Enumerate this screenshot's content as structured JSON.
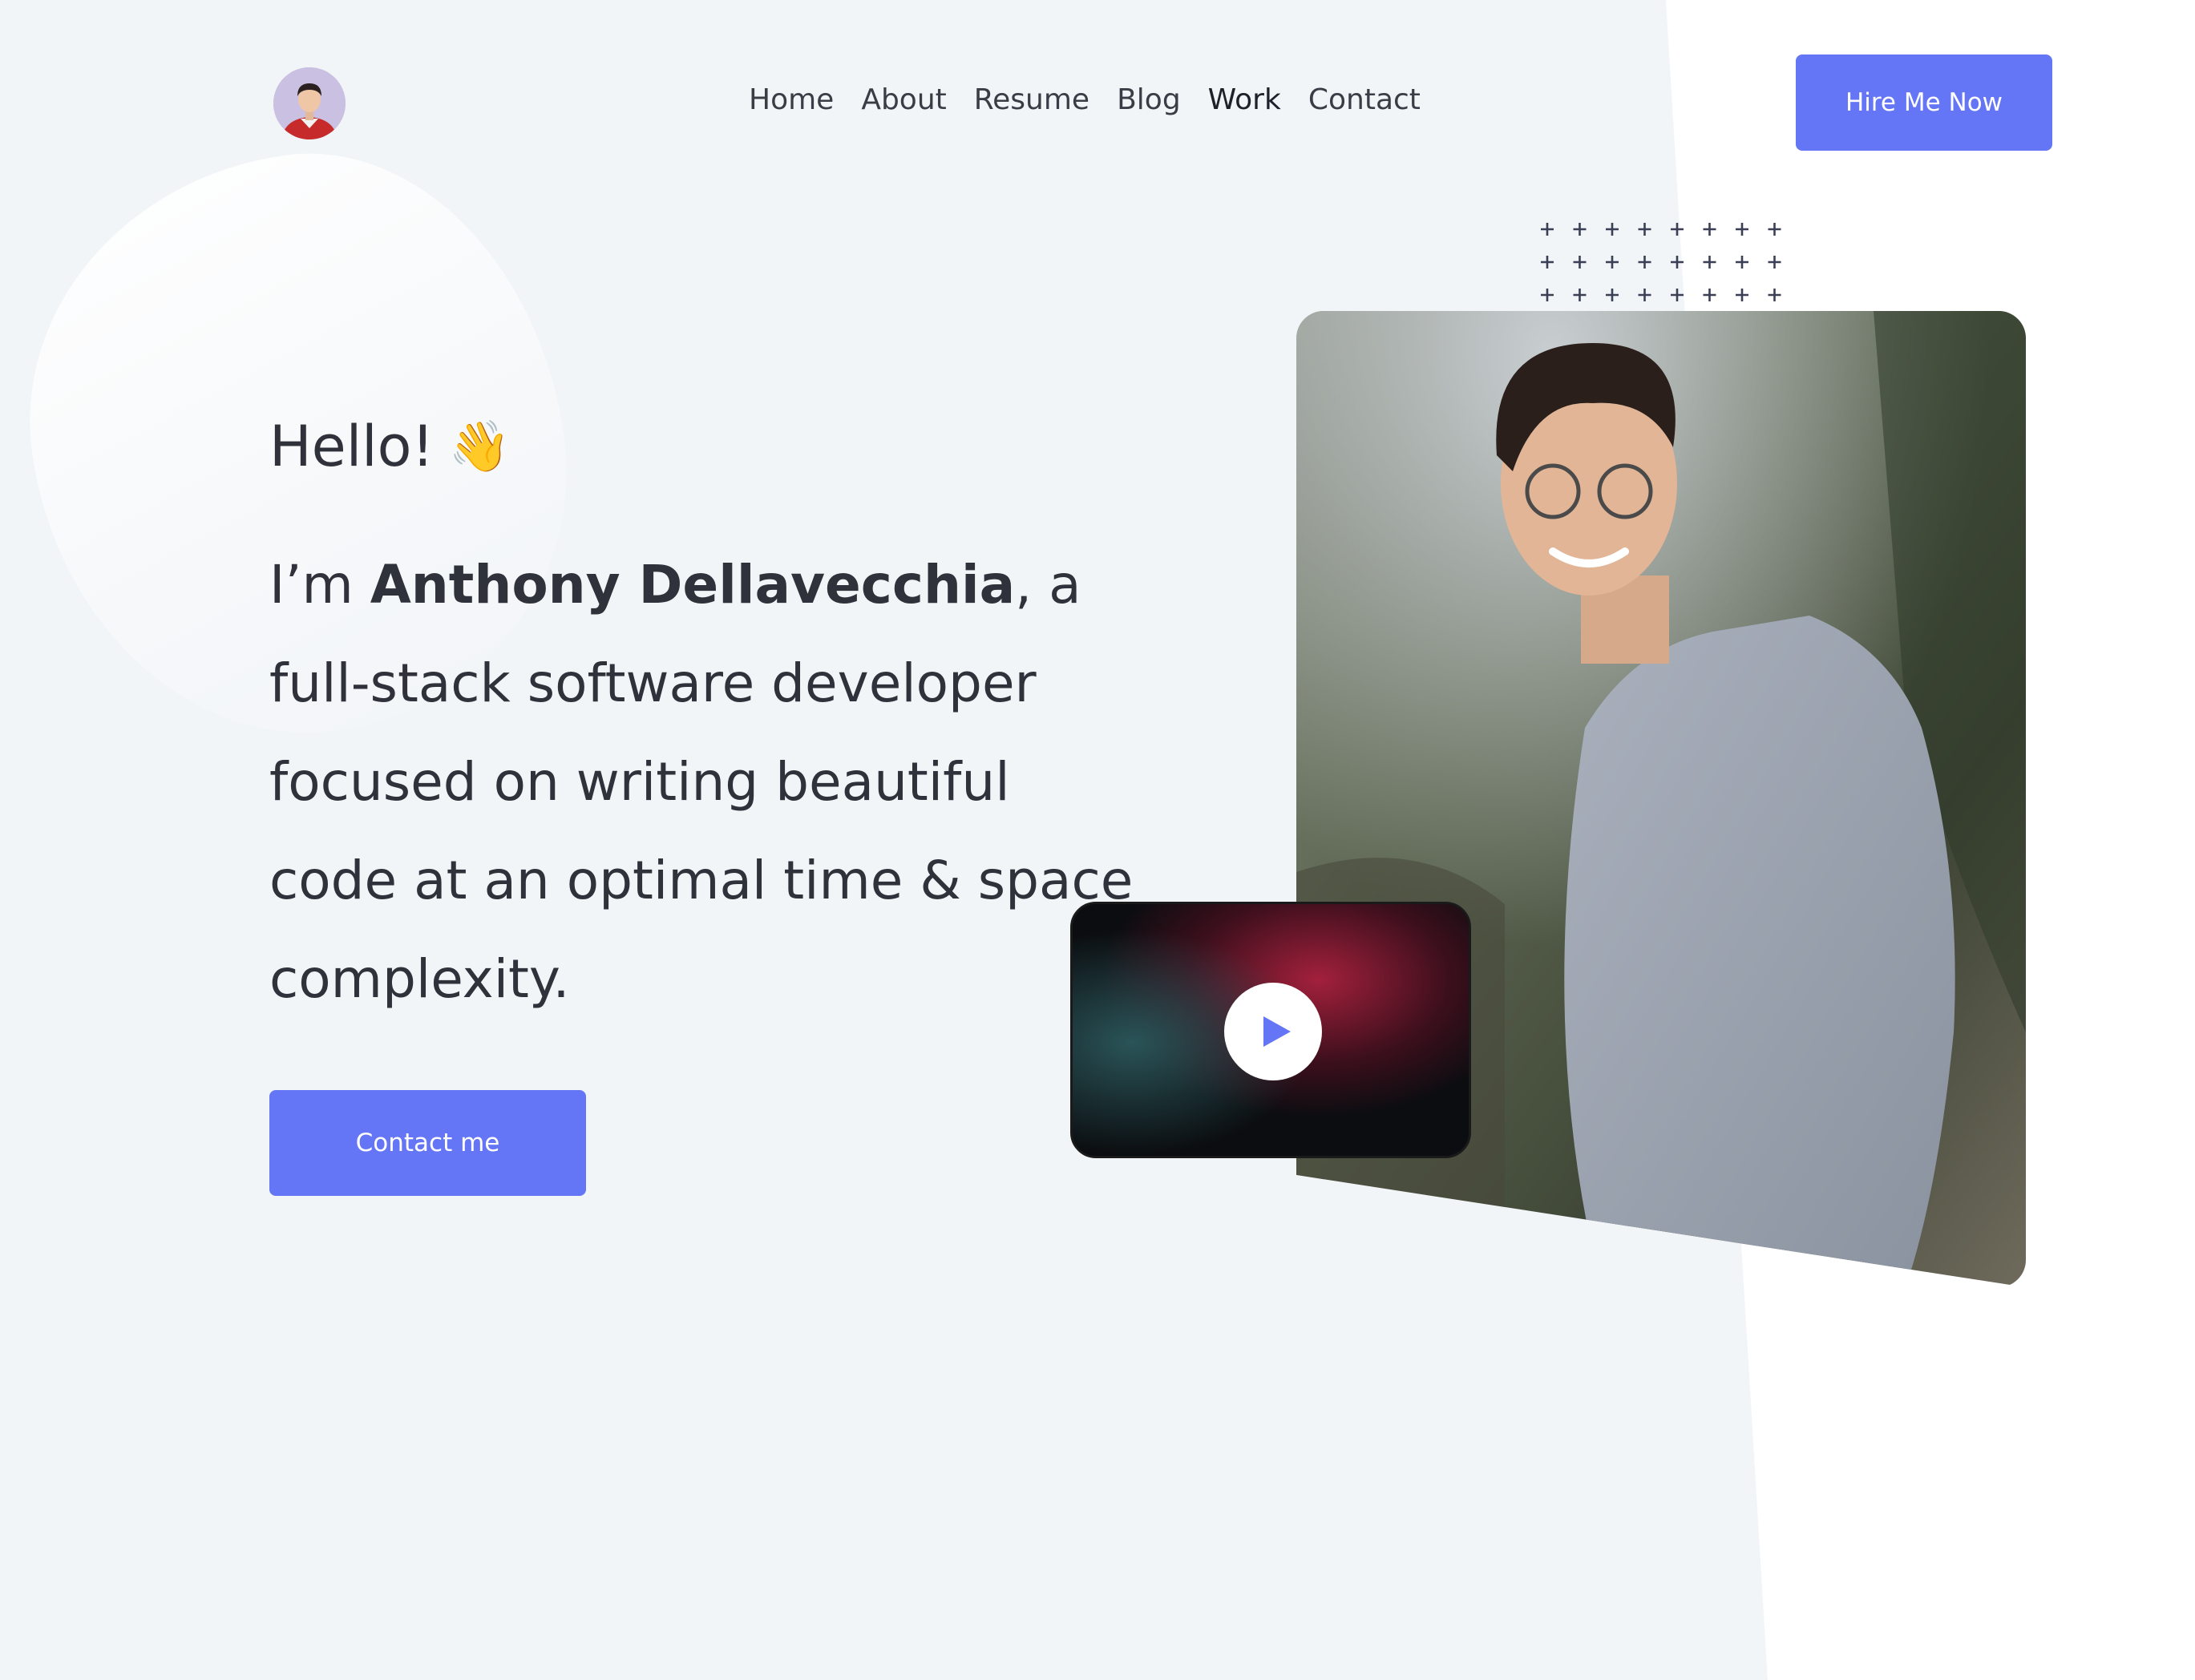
{
  "nav": {
    "avatar_icon": "user-avatar-icon",
    "links": [
      {
        "label": "Home"
      },
      {
        "label": "About"
      },
      {
        "label": "Resume"
      },
      {
        "label": "Blog"
      },
      {
        "label": "Work",
        "active": true
      },
      {
        "label": "Contact"
      }
    ],
    "hire_button": "Hire Me Now"
  },
  "hero": {
    "greeting": "Hello!",
    "greeting_emoji": "👋",
    "intro_prefix": "I’m ",
    "name": "Anthony Dellavecchia",
    "intro_suffix": ", a full-stack software developer focused on writing beautiful code at an optimal time & space complexity.",
    "contact_button": "Contact me"
  },
  "media": {
    "photo_icon": "profile-photo",
    "video_icon": "video-thumbnail",
    "play_icon": "play-icon"
  },
  "colors": {
    "accent": "#6476f5",
    "background": "#f2f5f8",
    "text": "#3a3d45"
  }
}
